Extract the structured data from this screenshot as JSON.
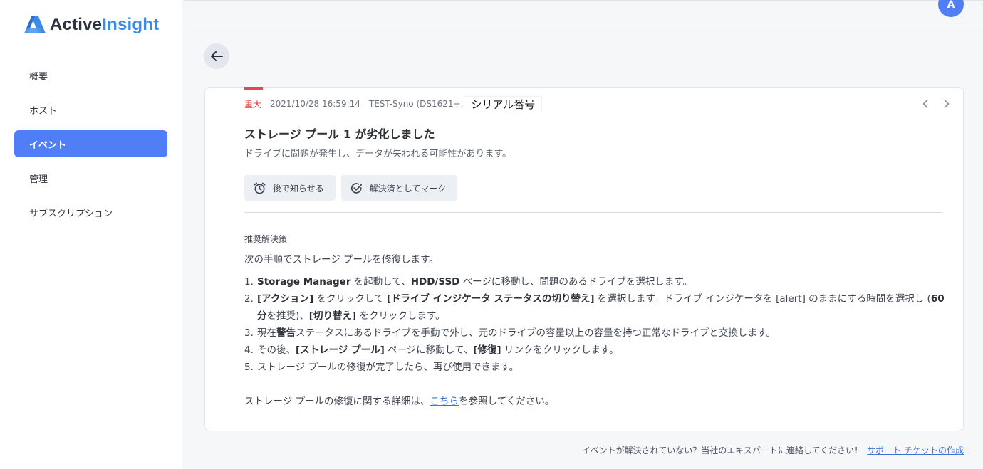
{
  "app": {
    "logo_part1": "Active",
    "logo_part2": "Insight",
    "avatar_initial": "A"
  },
  "sidebar": {
    "items": [
      {
        "label": "概要",
        "active": false
      },
      {
        "label": "ホスト",
        "active": false
      },
      {
        "label": "イベント",
        "active": true
      },
      {
        "label": "管理",
        "active": false
      },
      {
        "label": "サブスクリプション",
        "active": false
      }
    ]
  },
  "event": {
    "severity": "重大",
    "timestamp": "2021/10/28 16:59:14",
    "host": "TEST-Syno (DS1621+,",
    "serial": "シリアル番号",
    "title_pre": "ストレージ プール ",
    "title_num": "1",
    "title_post": " が劣化しました",
    "subtitle": "ドライブに問題が発生し、データが失われる可能性があります。",
    "remind_label": "後で知らせる",
    "resolve_label": "解決済としてマーク"
  },
  "solution": {
    "heading": "推奨解決策",
    "intro": "次の手順でストレージ プールを修復します。",
    "steps": [
      {
        "num": "1.",
        "parts": [
          [
            "b",
            "Storage Manager"
          ],
          [
            "t",
            " を起動して、"
          ],
          [
            "b",
            "HDD/SSD"
          ],
          [
            "t",
            " ページに移動し、問題のあるドライブを選択します。"
          ]
        ]
      },
      {
        "num": "2.",
        "parts": [
          [
            "b",
            "[アクション]"
          ],
          [
            "t",
            " をクリックして "
          ],
          [
            "b",
            "[ドライブ インジケータ ステータスの切り替え]"
          ],
          [
            "t",
            " を選択します。ドライブ インジケータを [alert] のままにする時間を選択し ("
          ],
          [
            "b",
            "60 分"
          ],
          [
            "t",
            "を推奨)、"
          ],
          [
            "b",
            "[切り替え]"
          ],
          [
            "t",
            " をクリックします。"
          ]
        ]
      },
      {
        "num": "3.",
        "parts": [
          [
            "t",
            "現在"
          ],
          [
            "b",
            "警告"
          ],
          [
            "t",
            "ステータスにあるドライブを手動で外し、元のドライブの容量以上の容量を持つ正常なドライブと交換します。"
          ]
        ]
      },
      {
        "num": "4.",
        "parts": [
          [
            "t",
            "その後、"
          ],
          [
            "b",
            "[ストレージ プール]"
          ],
          [
            "t",
            " ページに移動して、"
          ],
          [
            "b",
            "[修復]"
          ],
          [
            "t",
            " リンクをクリックします。"
          ]
        ]
      },
      {
        "num": "5.",
        "parts": [
          [
            "t",
            "ストレージ プールの修復が完了したら、再び使用できます。"
          ]
        ]
      }
    ],
    "more_pre": "ストレージ プールの修復に関する詳細は、",
    "more_link": "こちら",
    "more_post": "を参照してください。"
  },
  "footer": {
    "note": "イベントが解決されていない？当社のエキスパートに連絡してください！",
    "link": "サポート チケットの作成"
  },
  "colors": {
    "accent": "#4f7ef6",
    "severity_critical": "#e14b4b",
    "link": "#3d73d8",
    "logo_insight": "#3d8ae6"
  }
}
